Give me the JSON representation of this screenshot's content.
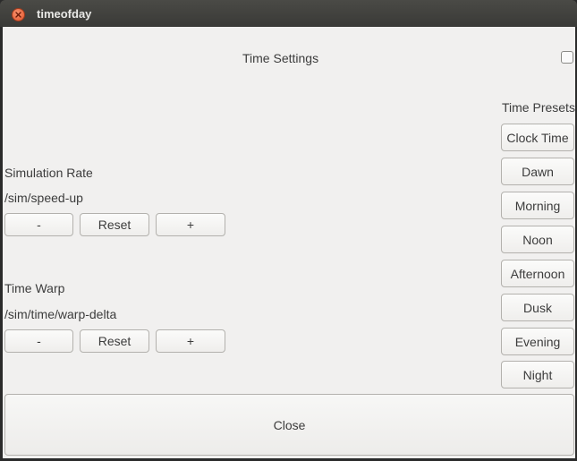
{
  "window": {
    "title": "timeofday"
  },
  "header": {
    "title": "Time Settings"
  },
  "simulation_rate": {
    "label": "Simulation Rate",
    "property": "/sim/speed-up",
    "buttons": {
      "minus": "-",
      "reset": "Reset",
      "plus": "+"
    }
  },
  "time_warp": {
    "label": "Time Warp",
    "property": "/sim/time/warp-delta",
    "buttons": {
      "minus": "-",
      "reset": "Reset",
      "plus": "+"
    }
  },
  "presets": {
    "heading": "Time Presets",
    "items": [
      "Clock Time",
      "Dawn",
      "Morning",
      "Noon",
      "Afternoon",
      "Dusk",
      "Evening",
      "Night"
    ]
  },
  "footer": {
    "close_label": "Close"
  }
}
